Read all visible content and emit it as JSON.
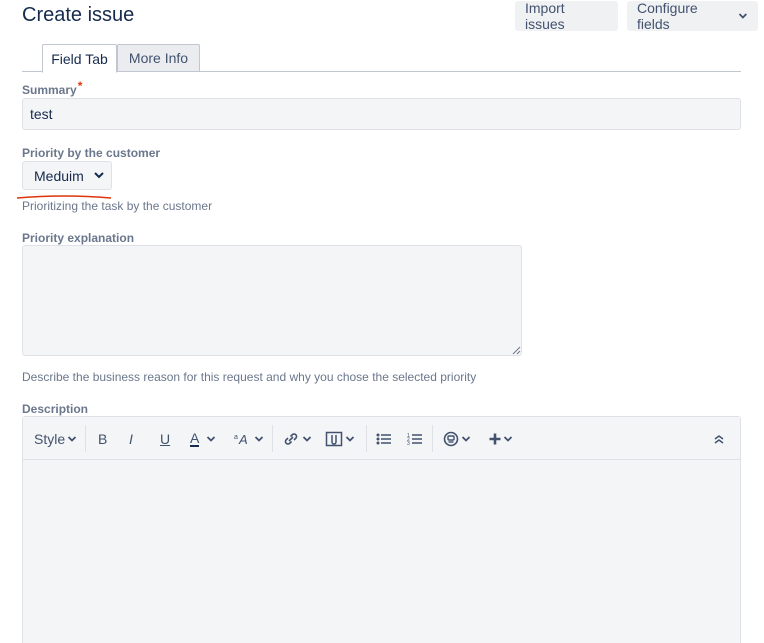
{
  "header": {
    "title": "Create issue",
    "import_label": "Import issues",
    "configure_label": "Configure fields"
  },
  "tabs": [
    {
      "label": "Field Tab",
      "active": true
    },
    {
      "label": "More Info",
      "active": false
    }
  ],
  "summary": {
    "label": "Summary",
    "required_marker": "*",
    "value": "test"
  },
  "priority": {
    "label": "Priority by the customer",
    "selected": "Meduim",
    "help": "Prioritizing the task by the customer"
  },
  "explanation": {
    "label": "Priority explanation",
    "value": "",
    "help": "Describe the business reason for this request and why you chose the selected priority"
  },
  "description": {
    "label": "Description",
    "toolbar": {
      "style_label": "Style",
      "bold": "B",
      "italic": "I",
      "underline": "U",
      "text_color": "A"
    }
  },
  "colors": {
    "accent_red": "#de350b",
    "field_bg": "#f4f5f7",
    "border": "#dfe1e6"
  }
}
